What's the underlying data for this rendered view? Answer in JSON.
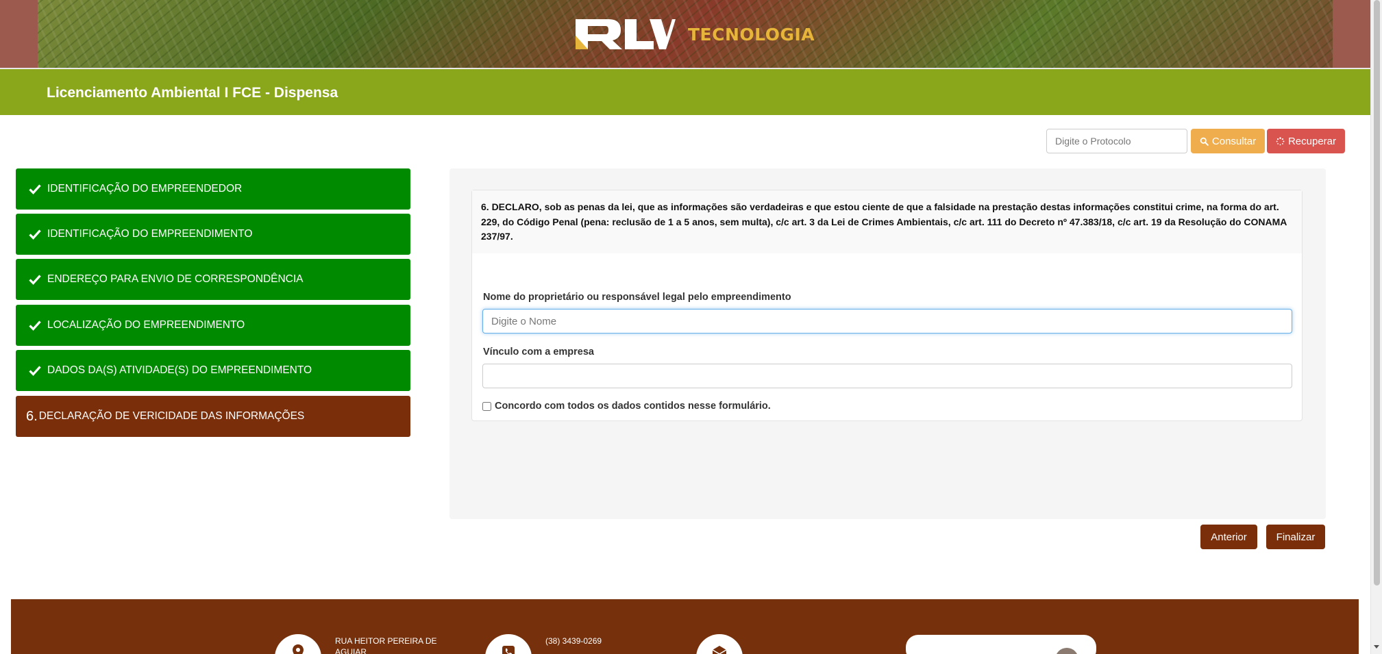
{
  "brand": {
    "logo_text": "RLV",
    "logo_sub": "TECNOLOGIA"
  },
  "header": {
    "title": "Licenciamento Ambiental I FCE - Dispensa"
  },
  "protocol": {
    "placeholder": "Digite o Protocolo",
    "consultar_label": "Consultar",
    "recuperar_label": "Recuperar"
  },
  "steps": [
    {
      "label": "IDENTIFICAÇÃO DO EMPREENDEDOR",
      "status": "done"
    },
    {
      "label": "IDENTIFICAÇÃO DO EMPREENDIMENTO",
      "status": "done"
    },
    {
      "label": "ENDEREÇO PARA ENVIO DE CORRESPONDÊNCIA",
      "status": "done"
    },
    {
      "label": "LOCALIZAÇÃO DO EMPREENDIMENTO",
      "status": "done"
    },
    {
      "label": "DADOS DA(S) ATIVIDADE(S) DO EMPREENDIMENTO",
      "status": "done"
    },
    {
      "number": "6.",
      "label": "DECLARAÇÃO DE VERICIDADE DAS INFORMAÇÕES",
      "status": "current"
    }
  ],
  "form": {
    "declaration": "6. DECLARO, sob as penas da lei, que as informações são verdadeiras e que estou ciente de que a falsidade na prestação destas informações constitui crime, na forma do art. 229, do Código Penal (pena: reclusão de 1 a 5 anos, sem multa), c/c art. 3 da Lei de Crimes Ambientais, c/c art. 111 do Decreto nº 47.383/18, c/c art. 19 da Resolução do CONAMA 237/97.",
    "owner_label": "Nome do proprietário ou responsável legal pelo empreendimento",
    "owner_placeholder": "Digite o Nome",
    "owner_value": "",
    "bond_label": "Vínculo com a empresa",
    "bond_value": "",
    "agree_label": "Concordo com todos os dados contidos nesse formulário.",
    "agree_checked": false
  },
  "actions": {
    "previous_label": "Anterior",
    "finish_label": "Finalizar"
  },
  "footer": {
    "address": "RUA HEITOR PEREIRA DE AGUIAR",
    "phone": "(38) 3439-0269"
  },
  "colors": {
    "title_bar": "#8aa61a",
    "step_done": "#008a00",
    "step_current": "#7a2e0a",
    "footer": "#76300b",
    "consultar": "#f0ad4e",
    "recuperar": "#d9534f"
  },
  "icons": {
    "step_done": "check-icon",
    "consultar": "search-icon",
    "recuperar": "spinner-icon",
    "footer": [
      "location-pin-icon",
      "phone-icon",
      "mail-icon"
    ]
  }
}
